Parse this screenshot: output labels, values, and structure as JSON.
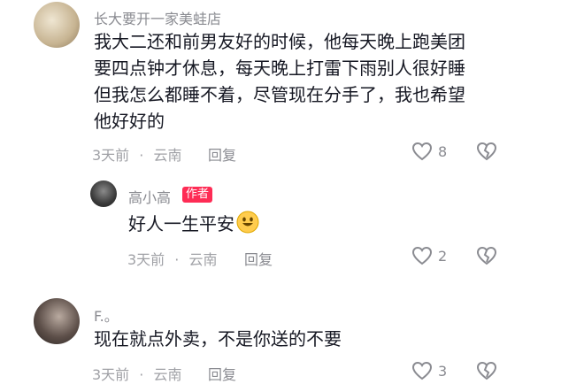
{
  "comments": [
    {
      "username": "长大要开一家美蛙店",
      "text_lines": [
        "我大二还和前男友好的时候，他每天晚上跑美团",
        "要四点钟才休息，每天晚上打雷下雨别人很好睡",
        "但我怎么都睡不着，尽管现在分手了，我也希望",
        "他好好的"
      ],
      "time": "3天前",
      "sep": "·",
      "location": "云南",
      "reply_label": "回复",
      "likes": "8"
    },
    {
      "username": "高小高",
      "badge": "作者",
      "text": "好人一生平安",
      "time": "3天前",
      "sep": "·",
      "location": "云南",
      "reply_label": "回复",
      "likes": "2"
    },
    {
      "username": "F.。",
      "text": "现在就点外卖，不是你送的不要",
      "time": "3天前",
      "sep": "·",
      "location": "云南",
      "reply_label": "回复",
      "likes": "3"
    }
  ],
  "icons": {
    "like": "heart-outline-icon",
    "dislike": "broken-heart-icon",
    "emoji": "grinning-face-emoji"
  },
  "colors": {
    "badge": "#fe2c55",
    "meta": "#a0a1a6",
    "text": "#161823"
  }
}
